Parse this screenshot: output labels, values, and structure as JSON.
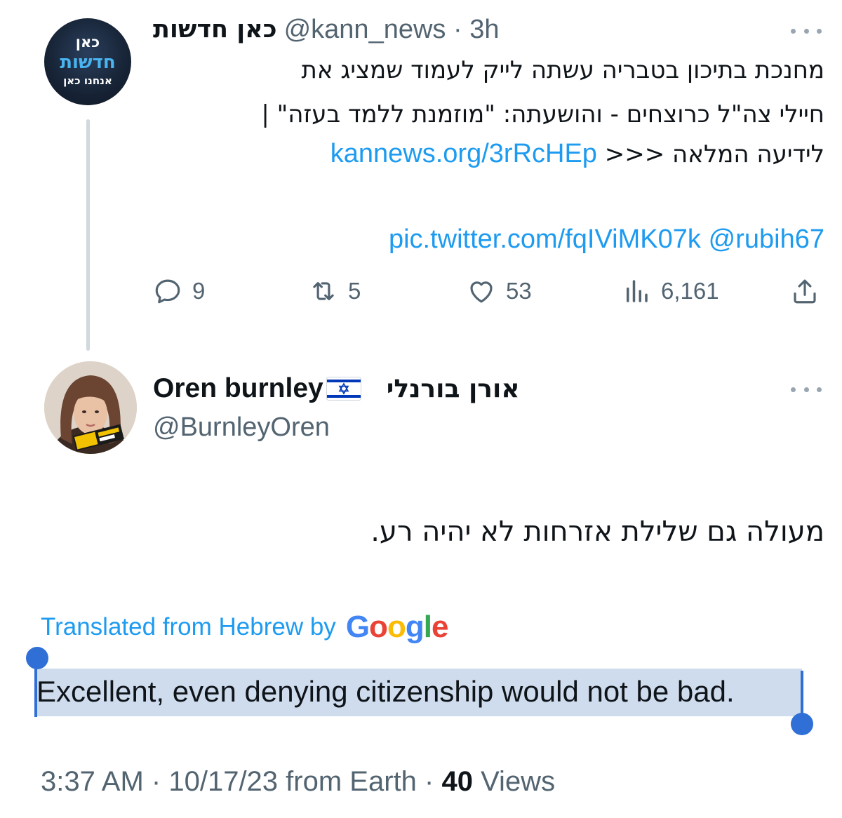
{
  "parent_tweet": {
    "avatar": {
      "line1": "כאן",
      "line2": "חדשות",
      "line3": "אנחנו כאן"
    },
    "display_name": "כאן חדשות",
    "handle": "@kann_news",
    "separator": "·",
    "time_ago": "3h",
    "body": {
      "line1": "מחנכת בתיכון בטבריה עשתה לייק לעמוד שמציג את",
      "line2": "חיילי צה\"ל כרוצחים - והושעתה: \"מוזמנת ללמד בעזה\" |",
      "line3_text": "לידיעה המלאה <<<",
      "line3_link": "kannews.org/3rRcHEp",
      "mention": "@rubih67",
      "pic_link": "pic.twitter.com/fqIViMK07k"
    },
    "actions": {
      "replies": "9",
      "retweets": "5",
      "likes": "53",
      "views": "6,161"
    }
  },
  "reply_tweet": {
    "display_name": "Oren burnley",
    "display_name_hebrew": "אורן בורנלי",
    "flag_icon": "israel-flag",
    "handle": "@BurnleyOren",
    "text_hebrew": "מעולה גם שלילת אזרחות לא יהיה רע.",
    "translated_label": "Translated from Hebrew by",
    "translator_logo_text": "Google",
    "translated_text": "Excellent, even denying citizenship would not be bad.",
    "footer": {
      "time": "3:37 AM",
      "date": "10/17/23",
      "source": "from Earth",
      "separator": "·",
      "views_count": "40",
      "views_label": "Views"
    }
  },
  "colors": {
    "link": "#1d9bf0",
    "secondary_text": "#536471",
    "selection": "#cfdcee",
    "selection_handle": "#2f6fd6",
    "google_blue": "#4285f4",
    "google_red": "#ea4335",
    "google_yellow": "#fbbc05",
    "google_green": "#34a853"
  }
}
